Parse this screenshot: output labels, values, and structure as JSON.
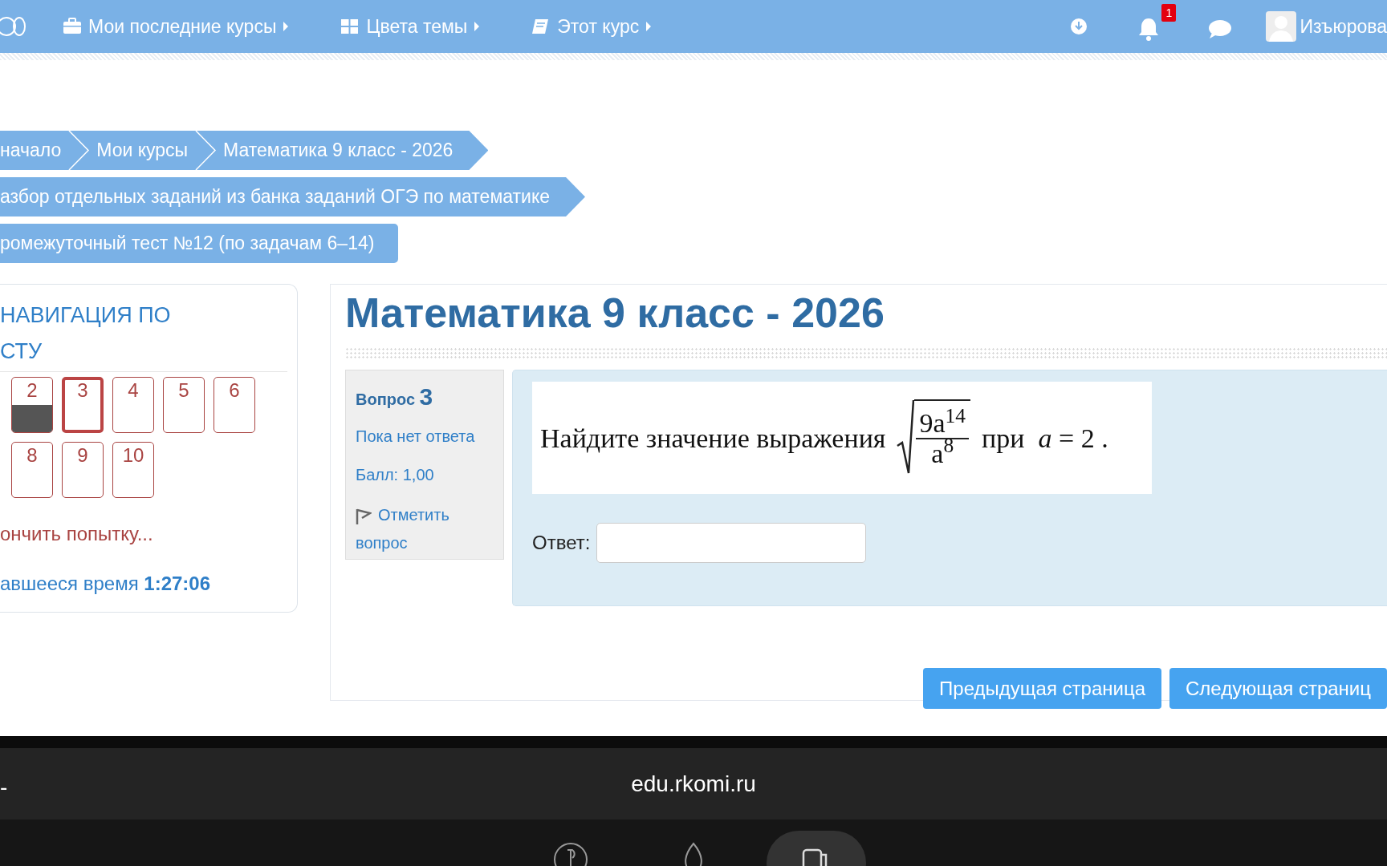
{
  "navbar": {
    "menus": [
      {
        "label": "Мои последние курсы"
      },
      {
        "label": "Цвета темы"
      },
      {
        "label": "Этот курс"
      }
    ],
    "notification_count": "1",
    "user_name": "Изъюрова"
  },
  "breadcrumbs": [
    {
      "kind": "arrow",
      "items": [
        "начало",
        "Мои курсы",
        "Математика 9 класс - 2026"
      ]
    },
    {
      "kind": "arrow",
      "items": [
        "азбор отдельных заданий из банка заданий ОГЭ по математике"
      ]
    },
    {
      "kind": "tab",
      "items": [
        "ромежуточный тест №12 (по задачам 6–14)"
      ]
    }
  ],
  "quiz_nav": {
    "title_lines": [
      "НАВИГАЦИЯ ПО",
      "СТУ"
    ],
    "rows": [
      [
        {
          "label": "2",
          "answered": true,
          "selected": false
        },
        {
          "label": "3",
          "answered": false,
          "selected": true
        },
        {
          "label": "4",
          "answered": false,
          "selected": false
        },
        {
          "label": "5",
          "answered": false,
          "selected": false
        },
        {
          "label": "6",
          "answered": false,
          "selected": false
        }
      ],
      [
        {
          "label": "8",
          "answered": false,
          "selected": false
        },
        {
          "label": "9",
          "answered": false,
          "selected": false
        },
        {
          "label": "10",
          "answered": false,
          "selected": false
        }
      ]
    ],
    "finish_link": "ончить попытку...",
    "time_left": "авшееся время **1:27:06**"
  },
  "page_title": "Математика 9 класс - 2026",
  "question_info": {
    "label": "Вопрос",
    "number": "3",
    "status": "Пока нет ответа",
    "grade": "Балл: 1,00",
    "flag_link": "Отметить вопрос"
  },
  "question": {
    "text": "Найдите значение выражения",
    "numerator": "9a$^{14}$",
    "denominator": "a$^{8}$",
    "tail": "при  *a* = 2 .",
    "answer_label": "Ответ:"
  },
  "buttons": [
    "Предыдущая страница",
    "Следующая страниц"
  ],
  "browser": {
    "left_fragment": "-",
    "url": "edu.rkomi.ru"
  }
}
